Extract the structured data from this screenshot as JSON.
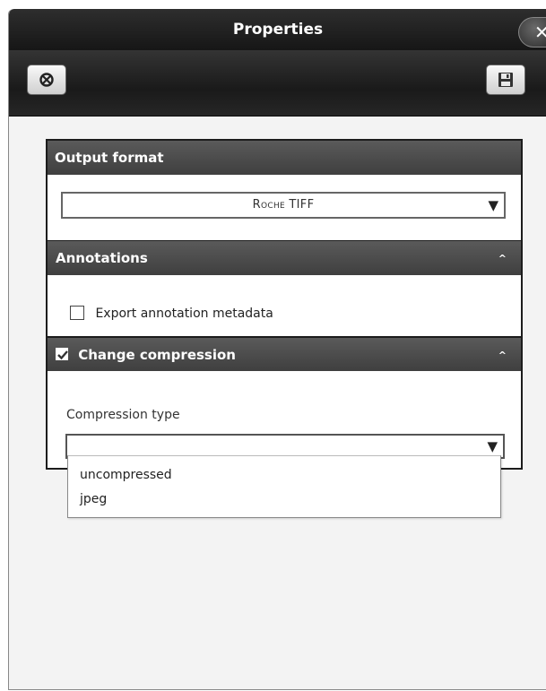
{
  "window": {
    "title": "Properties",
    "close_glyph": "✕"
  },
  "toolbar": {
    "left_button_icon": "reset-icon",
    "right_button_icon": "save-icon"
  },
  "output_format": {
    "heading": "Output format",
    "selected": "Roche TIFF",
    "arrow": "▼"
  },
  "annotations": {
    "heading": "Annotations",
    "caret": "^",
    "checkbox_label": "Export annotation metadata",
    "checked": false
  },
  "compression": {
    "heading": "Change compression",
    "checked": true,
    "caret": "^",
    "type_label": "Compression type",
    "selected": "",
    "arrow": "▼",
    "options": [
      "uncompressed",
      "jpeg"
    ]
  },
  "colors": {
    "header_dark": "#1a1a1a",
    "section_gray": "#4a4a4a",
    "panel_bg": "#f3f3f3"
  }
}
